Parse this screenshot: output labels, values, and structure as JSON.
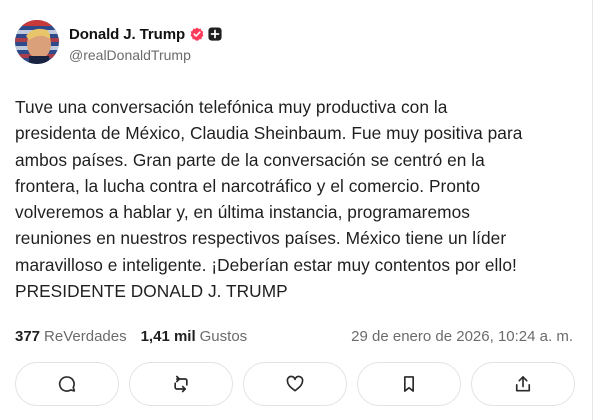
{
  "post": {
    "author": {
      "display_name": "Donald J. Trump",
      "handle": "@realDonaldTrump",
      "verified_color": "#ff3b5c"
    },
    "text": "Tuve una conversación telefónica muy productiva con la\npresidenta de México, Claudia Sheinbaum. Fue muy positiva para\nambos países. Gran parte de la conversación se centró en la\nfrontera, la lucha contra el narcotráfico y el comercio. Pronto\nvolveremos a hablar y, en última instancia, programaremos\nreuniones en nuestros respectivos países. México tiene un líder\nmaravilloso e inteligente. ¡Deberían estar muy contentos por ello!\nPRESIDENTE DONALD J. TRUMP",
    "stats": {
      "reposts_count": "377",
      "reposts_label": "ReVerdades",
      "likes_count": "1,41 mil",
      "likes_label": "Gustos"
    },
    "timestamp": "29 de enero de 2026, 10:24 a. m."
  },
  "actions": [
    {
      "icon": "comment-icon"
    },
    {
      "icon": "retruth-icon"
    },
    {
      "icon": "heart-icon"
    },
    {
      "icon": "bookmark-icon"
    },
    {
      "icon": "share-icon"
    }
  ],
  "colors": {
    "text": "#1f1f1f",
    "muted": "#6b6b6b",
    "border": "#e3e3e3",
    "verified_badge": "#ff3b5c"
  }
}
